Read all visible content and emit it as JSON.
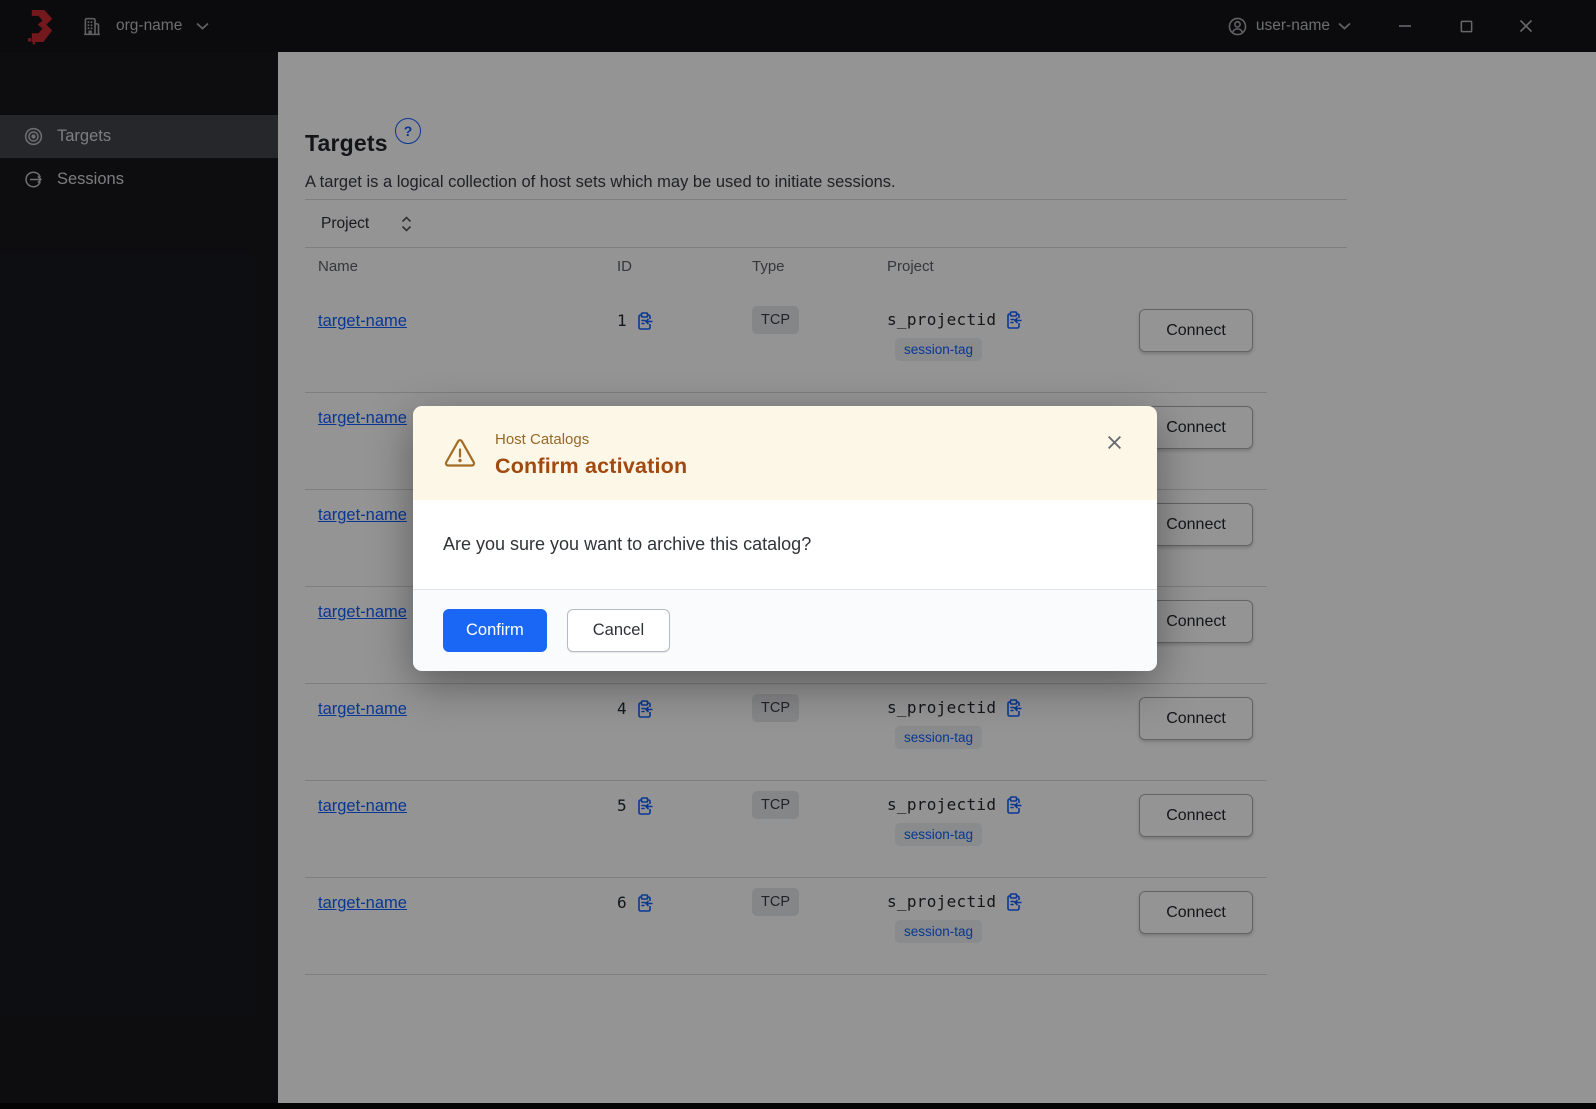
{
  "titlebar": {
    "org_name": "org-name",
    "user_name": "user-name"
  },
  "sidebar": {
    "items": [
      {
        "label": "Targets",
        "icon": "target-icon",
        "active": true
      },
      {
        "label": "Sessions",
        "icon": "entry-icon",
        "active": false
      }
    ]
  },
  "page": {
    "title": "Targets",
    "description": "A target is a logical collection of host sets which may be used to initiate sessions.",
    "filter": {
      "label": "Project"
    }
  },
  "table": {
    "columns": [
      "Name",
      "ID",
      "Type",
      "Project"
    ],
    "connect_label": "Connect",
    "rows": [
      {
        "name": "target-name",
        "id": "1",
        "type": "TCP",
        "project": "s_projectid",
        "session_tag": "session-tag"
      },
      {
        "name": "target-name",
        "id": "",
        "type": "",
        "project": "",
        "session_tag": ""
      },
      {
        "name": "target-name",
        "id": "",
        "type": "",
        "project": "",
        "session_tag": ""
      },
      {
        "name": "target-name",
        "id": "",
        "type": "",
        "project": "",
        "session_tag": ""
      },
      {
        "name": "target-name",
        "id": "4",
        "type": "TCP",
        "project": "s_projectid",
        "session_tag": "session-tag"
      },
      {
        "name": "target-name",
        "id": "5",
        "type": "TCP",
        "project": "s_projectid",
        "session_tag": "session-tag"
      },
      {
        "name": "target-name",
        "id": "6",
        "type": "TCP",
        "project": "s_projectid",
        "session_tag": "session-tag"
      }
    ]
  },
  "modal": {
    "tagline": "Host Catalogs",
    "title": "Confirm activation",
    "body": "Are you sure you want to archive this catalog?",
    "confirm_label": "Confirm",
    "cancel_label": "Cancel"
  },
  "icons": {
    "brand": "boundary-logo",
    "org": "org-building-icon",
    "user": "user-icon",
    "dropdowns": "chevron-down-icon",
    "window": [
      "minimize-icon",
      "maximize-icon",
      "close-icon"
    ],
    "sidebar": [
      "target-icon",
      "entry-icon"
    ],
    "help": "help-icon",
    "copy": "clipboard-copy-icon",
    "filter_sort": "sort-icon",
    "modal_warning": "alert-triangle-icon",
    "modal_close": "close-icon"
  },
  "colors": {
    "accent_blue": "#1060ff",
    "brand_red": "#c62a32",
    "warning_surface": "#fdf7e8",
    "warning_tagline": "#96682a",
    "warning_title": "#a1490f",
    "primary_button": "#1a66f5"
  }
}
